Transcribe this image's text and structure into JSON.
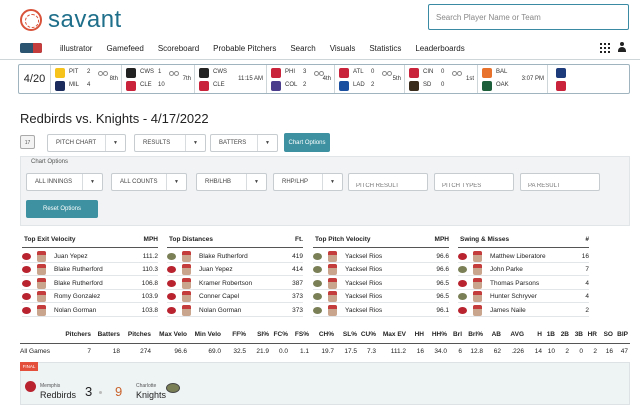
{
  "header": {
    "brand": "savant",
    "search_placeholder": "Search Player Name or Team"
  },
  "nav": {
    "items": [
      "illustrator",
      "Gamefeed",
      "Scoreboard",
      "Probable Pitchers",
      "Search",
      "Visuals",
      "Statistics",
      "Leaderboards"
    ]
  },
  "scoreboard": {
    "date": "4/20",
    "games": [
      {
        "away": "PIT",
        "away_score": "2",
        "home": "MIL",
        "home_score": "4",
        "status": "8th",
        "away_color": "#f6c31c",
        "home_color": "#1b2c5c"
      },
      {
        "away": "CWS",
        "away_score": "1",
        "home": "CLE",
        "home_score": "10",
        "status": "7th",
        "away_color": "#222222",
        "home_color": "#c8233b"
      },
      {
        "away": "CWS",
        "away_score": "",
        "home": "CLE",
        "home_score": "",
        "status": "11:15 AM",
        "away_color": "#222222",
        "home_color": "#c8233b"
      },
      {
        "away": "PHI",
        "away_score": "3",
        "home": "COL",
        "home_score": "2",
        "status": "4th",
        "away_color": "#c8233b",
        "home_color": "#4b3c8c"
      },
      {
        "away": "ATL",
        "away_score": "0",
        "home": "LAD",
        "home_score": "2",
        "status": "5th",
        "away_color": "#c8233b",
        "home_color": "#1a4fa0"
      },
      {
        "away": "CIN",
        "away_score": "0",
        "home": "SD",
        "home_score": "0",
        "status": "1st",
        "away_color": "#c8233b",
        "home_color": "#3a2c1c"
      },
      {
        "away": "BAL",
        "away_score": "",
        "home": "OAK",
        "home_score": "",
        "status": "3:07 PM",
        "away_color": "#e8712b",
        "home_color": "#1d5e3a"
      },
      {
        "away": "",
        "away_score": "",
        "home": "",
        "home_score": "",
        "status": "",
        "away_color": "#1d3a7a",
        "home_color": "#c8233b"
      }
    ]
  },
  "page": {
    "title": "Redbirds vs. Knights - 4/17/2022"
  },
  "filters": {
    "calendar_label": "17",
    "pitch_chart": "PITCH CHART",
    "results": "RESULTS",
    "batters": "BATTERS",
    "chart_options": "Chart Options"
  },
  "chart_options": {
    "label": "Chart Options",
    "all_innings": "ALL INNINGS",
    "all_counts": "ALL COUNTS",
    "rhb_lhb": "RHB/LHB",
    "rhp_lhp": "RHP/LHP",
    "pitch_result_placeholder": "PITCH RESULT",
    "pitch_types_placeholder": "PITCH TYPES",
    "pa_result_placeholder": "PA RESULT",
    "reset": "Reset Options"
  },
  "leaderboards": [
    {
      "title": "Top Exit Velocity",
      "unit": "MPH",
      "rows": [
        {
          "name": "Juan Yepez",
          "value": "111.2",
          "team": "redbirds"
        },
        {
          "name": "Blake Rutherford",
          "value": "110.3",
          "team": "redbirds"
        },
        {
          "name": "Blake Rutherford",
          "value": "106.8",
          "team": "redbirds"
        },
        {
          "name": "Romy Gonzalez",
          "value": "103.9",
          "team": "redbirds"
        },
        {
          "name": "Nolan Gorman",
          "value": "103.8",
          "team": "redbirds"
        }
      ]
    },
    {
      "title": "Top Distances",
      "unit": "Ft.",
      "rows": [
        {
          "name": "Blake Rutherford",
          "value": "419",
          "team": "knights"
        },
        {
          "name": "Juan Yepez",
          "value": "414",
          "team": "redbirds"
        },
        {
          "name": "Kramer Robertson",
          "value": "387",
          "team": "redbirds"
        },
        {
          "name": "Conner Capel",
          "value": "373",
          "team": "redbirds"
        },
        {
          "name": "Nolan Gorman",
          "value": "373",
          "team": "redbirds"
        }
      ]
    },
    {
      "title": "Top Pitch Velocity",
      "unit": "MPH",
      "rows": [
        {
          "name": "Yacksel Rios",
          "value": "96.6",
          "team": "knights"
        },
        {
          "name": "Yacksel Rios",
          "value": "96.6",
          "team": "knights"
        },
        {
          "name": "Yacksel Rios",
          "value": "96.5",
          "team": "knights"
        },
        {
          "name": "Yacksel Rios",
          "value": "96.5",
          "team": "knights"
        },
        {
          "name": "Yacksel Rios",
          "value": "96.1",
          "team": "knights"
        }
      ]
    },
    {
      "title": "Swing & Misses",
      "unit": "#",
      "rows": [
        {
          "name": "Matthew Liberatore",
          "value": "16",
          "team": "redbirds"
        },
        {
          "name": "John Parke",
          "value": "7",
          "team": "knights"
        },
        {
          "name": "Thomas Parsons",
          "value": "4",
          "team": "redbirds"
        },
        {
          "name": "Hunter Schryver",
          "value": "4",
          "team": "knights"
        },
        {
          "name": "James Naile",
          "value": "2",
          "team": "redbirds"
        }
      ]
    }
  ],
  "stats": {
    "headers": [
      "Pitchers",
      "Batters",
      "Pitches",
      "Max Velo",
      "Min Velo",
      "FF%",
      "SI%",
      "FC%",
      "FS%",
      "CH%",
      "SL%",
      "CU%",
      "Max EV",
      "HH",
      "HH%",
      "Brl",
      "Brl%",
      "AB",
      "AVG",
      "H",
      "1B",
      "2B",
      "3B",
      "HR",
      "SO",
      "BIP"
    ],
    "row_label": "All Games",
    "values": [
      "7",
      "18",
      "274",
      "96.6",
      "69.0",
      "32.5",
      "21.9",
      "0.0",
      "1.1",
      "19.7",
      "17.5",
      "7.3",
      "111.2",
      "16",
      "34.0",
      "6",
      "12.8",
      "62",
      ".226",
      "14",
      "10",
      "2",
      "0",
      "2",
      "16",
      "47"
    ]
  },
  "final": {
    "badge": "FINAL",
    "away_city": "Memphis",
    "away_team": "Redbirds",
    "away_score": "3",
    "home_city": "Charlotte",
    "home_team": "Knights",
    "home_score": "9"
  }
}
